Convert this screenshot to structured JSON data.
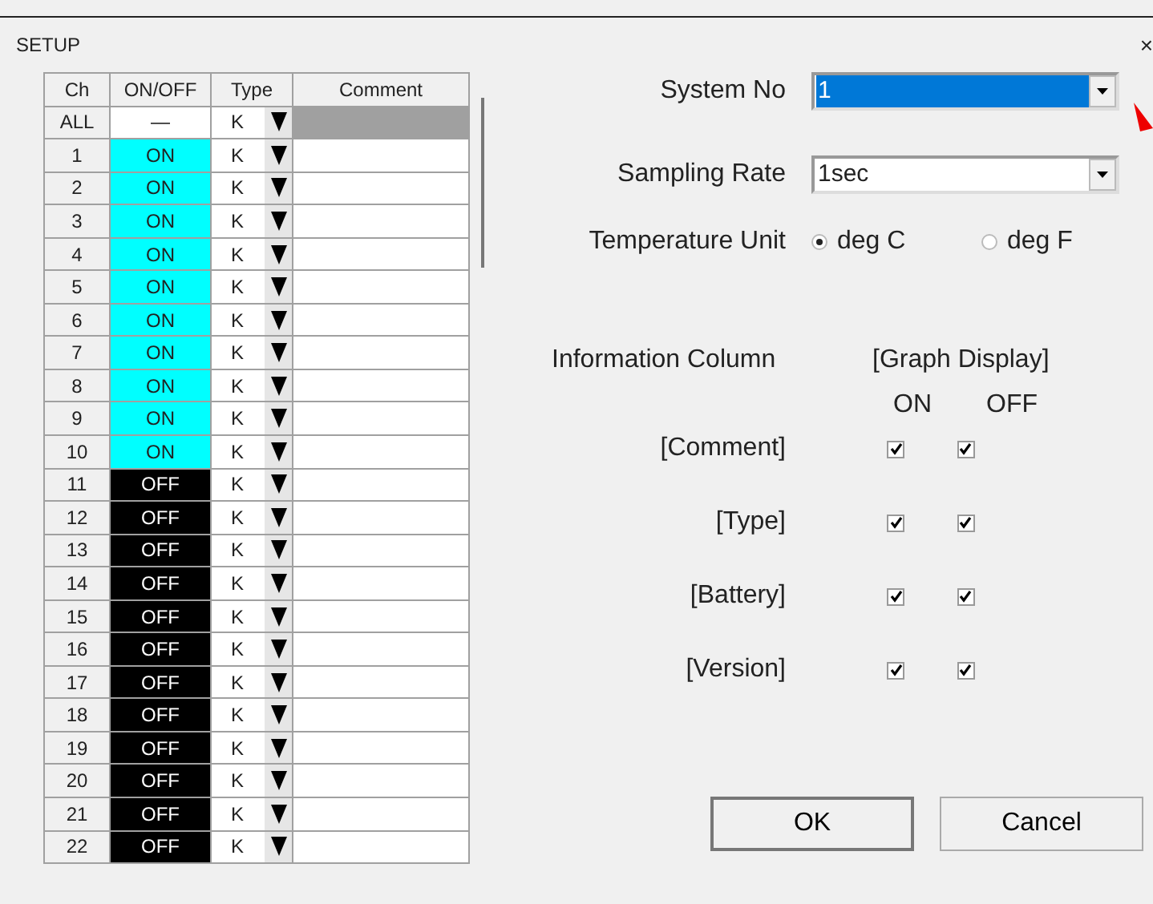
{
  "window": {
    "title": "SETUP",
    "close": "×"
  },
  "table": {
    "columns": [
      "Ch",
      "ON/OFF",
      "Type",
      "Comment"
    ],
    "all_row": {
      "ch": "ALL",
      "on_off": "—",
      "type": "K"
    },
    "rows": [
      {
        "ch": "1",
        "on": true,
        "label": "ON",
        "type": "K"
      },
      {
        "ch": "2",
        "on": true,
        "label": "ON",
        "type": "K"
      },
      {
        "ch": "3",
        "on": true,
        "label": "ON",
        "type": "K"
      },
      {
        "ch": "4",
        "on": true,
        "label": "ON",
        "type": "K"
      },
      {
        "ch": "5",
        "on": true,
        "label": "ON",
        "type": "K"
      },
      {
        "ch": "6",
        "on": true,
        "label": "ON",
        "type": "K"
      },
      {
        "ch": "7",
        "on": true,
        "label": "ON",
        "type": "K"
      },
      {
        "ch": "8",
        "on": true,
        "label": "ON",
        "type": "K"
      },
      {
        "ch": "9",
        "on": true,
        "label": "ON",
        "type": "K"
      },
      {
        "ch": "10",
        "on": true,
        "label": "ON",
        "type": "K"
      },
      {
        "ch": "11",
        "on": false,
        "label": "OFF",
        "type": "K"
      },
      {
        "ch": "12",
        "on": false,
        "label": "OFF",
        "type": "K"
      },
      {
        "ch": "13",
        "on": false,
        "label": "OFF",
        "type": "K"
      },
      {
        "ch": "14",
        "on": false,
        "label": "OFF",
        "type": "K"
      },
      {
        "ch": "15",
        "on": false,
        "label": "OFF",
        "type": "K"
      },
      {
        "ch": "16",
        "on": false,
        "label": "OFF",
        "type": "K"
      },
      {
        "ch": "17",
        "on": false,
        "label": "OFF",
        "type": "K"
      },
      {
        "ch": "18",
        "on": false,
        "label": "OFF",
        "type": "K"
      },
      {
        "ch": "19",
        "on": false,
        "label": "OFF",
        "type": "K"
      },
      {
        "ch": "20",
        "on": false,
        "label": "OFF",
        "type": "K"
      },
      {
        "ch": "21",
        "on": false,
        "label": "OFF",
        "type": "K"
      },
      {
        "ch": "22",
        "on": false,
        "label": "OFF",
        "type": "K"
      }
    ]
  },
  "system_no": {
    "label": "System No",
    "value": "1",
    "selected": true
  },
  "sampling_rate": {
    "label": "Sampling Rate",
    "value": "1sec",
    "selected": false
  },
  "temperature_unit": {
    "label": "Temperature Unit",
    "options": [
      {
        "label": "deg C",
        "selected": true
      },
      {
        "label": "deg F",
        "selected": false
      }
    ]
  },
  "information_column": {
    "label": "Information Column",
    "heading": "[Graph Display]",
    "columns": [
      "ON",
      "OFF"
    ],
    "rows": [
      {
        "label": "[Comment]",
        "on": true,
        "off": true
      },
      {
        "label": "[Type]",
        "on": true,
        "off": true
      },
      {
        "label": "[Battery]",
        "on": true,
        "off": true
      },
      {
        "label": "[Version]",
        "on": true,
        "off": true
      }
    ]
  },
  "buttons": [
    {
      "label": "OK",
      "default": true
    },
    {
      "label": "Cancel",
      "default": false
    }
  ]
}
